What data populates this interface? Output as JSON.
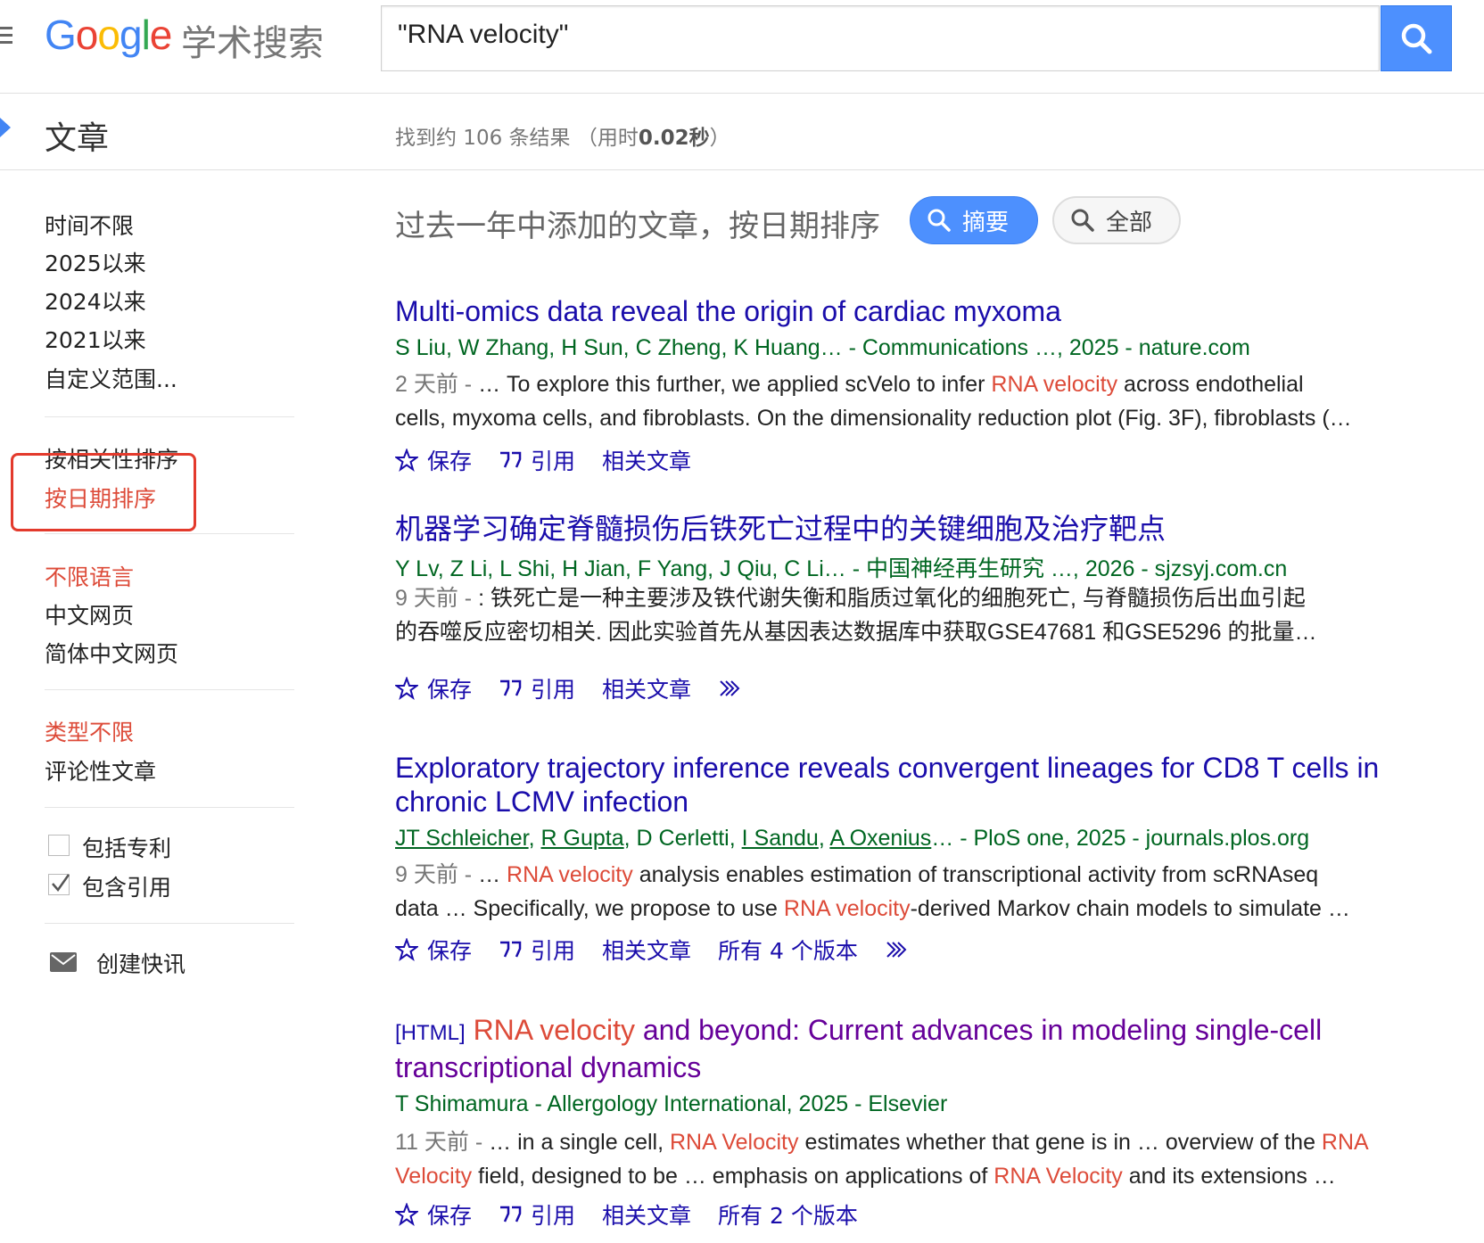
{
  "header": {
    "logo_text": "Google",
    "logo_sub": "学术搜索",
    "search_value": "\"RNA velocity\""
  },
  "subbar": {
    "section_title": "文章",
    "stats_prefix": "找到约 106 条结果 （用时",
    "stats_time": "0.02秒",
    "stats_suffix": "）"
  },
  "sidebar": {
    "time_filters": [
      "时间不限",
      "2025以来",
      "2024以来",
      "2021以来",
      "自定义范围..."
    ],
    "sort": [
      "按相关性排序",
      "按日期排序"
    ],
    "language": [
      "不限语言",
      "中文网页",
      "简体中文网页"
    ],
    "type": [
      "类型不限",
      "评论性文章"
    ],
    "include_patents": "包括专利",
    "include_citations": "包含引用",
    "create_alert": "创建快讯"
  },
  "main": {
    "sort_note": "过去一年中添加的文章，按日期排序",
    "pill_abstract": "摘要",
    "pill_all": "全部"
  },
  "results": [
    {
      "title": "Multi-omics data reveal the origin of cardiac myxoma",
      "authors": "S Liu, W Zhang, H Sun, C Zheng, K Huang… - Communications …, 2025 - nature.com",
      "age": "2 天前 - ",
      "snip1a": "… To explore this further, we applied scVelo to infer ",
      "snip1hl": "RNA velocity",
      "snip1b": " across endothelial",
      "snip2": "cells, myxoma cells, and fibroblasts. On the dimensionality reduction plot (Fig. 3F), fibroblasts (…",
      "save": "保存",
      "cite": "引用",
      "related": "相关文章"
    },
    {
      "title": "机器学习确定脊髓损伤后铁死亡过程中的关键细胞及治疗靶点",
      "authors": "Y Lv, Z Li, L Shi, H Jian, F Yang, J Qiu, C Li… - 中国神经再生研究 …, 2026 - sjzsyj.com.cn",
      "age": "9 天前 - ",
      "snip1": ": 铁死亡是一种主要涉及铁代谢失衡和脂质过氧化的细胞死亡, 与脊髓损伤后出血引起",
      "snip2": "的吞噬反应密切相关. 因此实验首先从基因表达数据库中获取GSE47681 和GSE5296 的批量…",
      "save": "保存",
      "cite": "引用",
      "related": "相关文章"
    },
    {
      "title_line1": "Exploratory trajectory inference reveals convergent lineages for CD8 T cells in",
      "title_line2": "chronic LCMV infection",
      "author_a": "JT Schleicher",
      "author_b": "R Gupta",
      "author_c": "D Cerletti",
      "author_d": "I Sandu",
      "author_e": "A Oxenius",
      "author_tail": "… - PloS one, 2025 - journals.plos.org",
      "age": "9 天前 - ",
      "snip1a": "… ",
      "snip1hl": "RNA velocity",
      "snip1b": " analysis enables estimation of transcriptional activity from scRNAseq",
      "snip2a": "data … Specifically, we propose to use ",
      "snip2hl": "RNA velocity",
      "snip2b": "-derived Markov chain models to simulate …",
      "save": "保存",
      "cite": "引用",
      "related": "相关文章",
      "versions": "所有 4 个版本"
    },
    {
      "tag": "[HTML]",
      "title_hl": "RNA velocity",
      "title_rest1": " and beyond: Current advances in modeling single-cell",
      "title_line2": "transcriptional dynamics",
      "authors": "T Shimamura - Allergology International, 2025 - Elsevier",
      "age": "11 天前 - ",
      "snip1a": "… in a single cell, ",
      "snip1hl1": "RNA Velocity",
      "snip1b": " estimates whether that gene is in … overview of the ",
      "snip1hl2": "RNA",
      "snip2hl0": "Velocity",
      "snip2a": " field, designed to be … emphasis on applications of ",
      "snip2hl": "RNA Velocity",
      "snip2b": " and its extensions …",
      "save": "保存",
      "cite": "引用",
      "related": "相关文章",
      "versions": "所有 2 个版本"
    }
  ],
  "colors": {
    "link": "#1a0dab",
    "visited": "#660099",
    "green": "#006621",
    "highlight": "#dd4b39",
    "accent": "#4d90fe"
  }
}
